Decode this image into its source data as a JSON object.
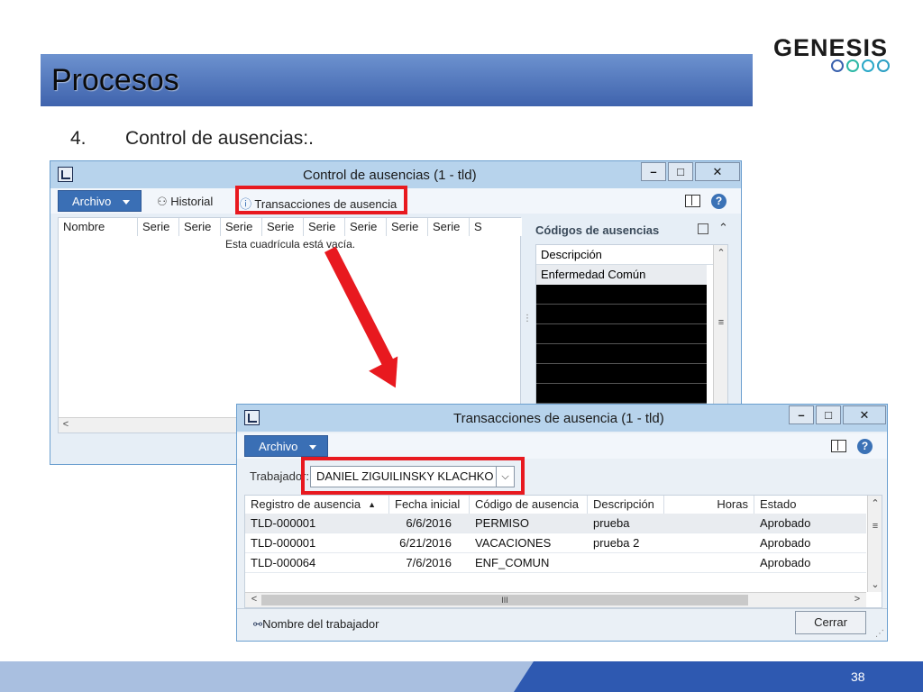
{
  "slide": {
    "title": "Procesos",
    "step_number": "4.",
    "step_text": "Control de ausencias:.",
    "page_number": "38"
  },
  "logo": {
    "text": "GENESIS"
  },
  "window_control": {
    "title": "Control de ausencias (1 - tld)",
    "archivo_label": "Archivo",
    "historial_label": "Historial",
    "transacciones_label": "Transacciones de ausencia",
    "columns": [
      "Nombre",
      "Serie",
      "Serie",
      "Serie",
      "Serie",
      "Serie",
      "Serie",
      "Serie",
      "Serie",
      "S"
    ],
    "empty_message": "Esta cuadrícula está vacía.",
    "codes_panel": {
      "title": "Códigos de ausencias",
      "header": "Descripción",
      "rows": [
        "Enfermedad Común"
      ]
    }
  },
  "window_trans": {
    "title": "Transacciones de ausencia (1 - tld)",
    "archivo_label": "Archivo",
    "worker_label": "Trabajador:",
    "worker_value": "DANIEL ZIGUILINSKY KLACHKO",
    "columns": [
      "Registro de ausencia",
      "Fecha inicial",
      "Código de ausencia",
      "Descripción",
      "Horas",
      "Estado"
    ],
    "rows": [
      {
        "registro": "TLD-000001",
        "fecha": "6/6/2016",
        "codigo": "PERMISO",
        "descripcion": "prueba",
        "horas": "",
        "estado": "Aprobado"
      },
      {
        "registro": "TLD-000001",
        "fecha": "6/21/2016",
        "codigo": "VACACIONES",
        "descripcion": "prueba 2",
        "horas": "",
        "estado": "Aprobado"
      },
      {
        "registro": "TLD-000064",
        "fecha": "7/6/2016",
        "codigo": "ENF_COMUN",
        "descripcion": "",
        "horas": "",
        "estado": "Aprobado"
      }
    ],
    "scroll_label": "III",
    "footer_link": "Nombre del trabajador",
    "cerrar_label": "Cerrar"
  },
  "colors": {
    "highlight": "#e8191f",
    "title_bar": "#3f63ad",
    "footer_dark": "#2e59b1"
  }
}
